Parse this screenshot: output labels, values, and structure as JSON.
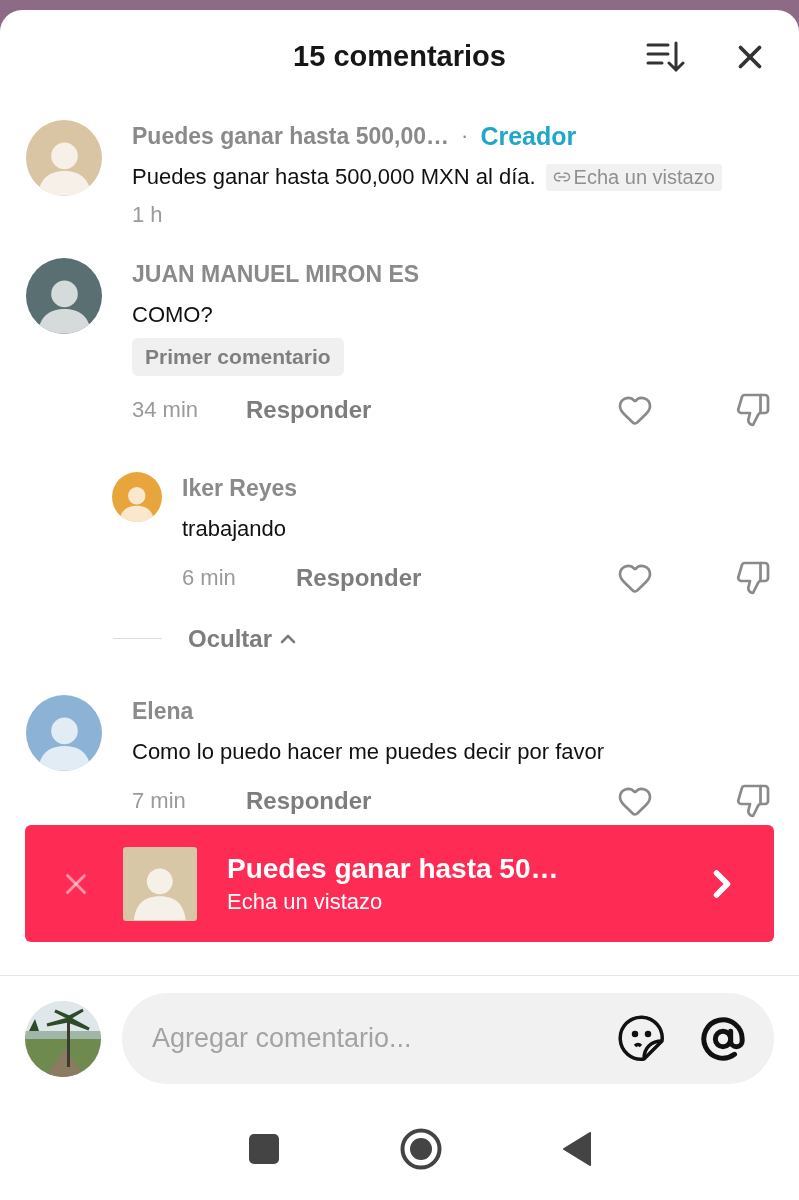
{
  "header": {
    "title": "15 comentarios"
  },
  "comments": [
    {
      "kind": "comment",
      "author": "Puedes ganar hasta 500,00…",
      "separator": "·",
      "author_tag": "Creador",
      "text": "Puedes ganar hasta 500,000 MXN al día.",
      "link": "Echa un vistazo",
      "time": "1 h"
    },
    {
      "kind": "comment",
      "author": "JUAN MANUEL MIRON ES",
      "text": "COMO?",
      "badge": "Primer comentario",
      "time": "34 min",
      "reply_label": "Responder"
    },
    {
      "kind": "reply",
      "author": "Iker Reyes",
      "text": "trabajando",
      "time": "6 min",
      "reply_label": "Responder"
    },
    {
      "kind": "toggle",
      "label": "Ocultar"
    },
    {
      "kind": "comment",
      "author": "Elena",
      "text": "Como lo puedo hacer me puedes decir por favor",
      "time": "7 min",
      "reply_label": "Responder"
    }
  ],
  "banner": {
    "title": "Puedes ganar hasta 50…",
    "subtitle": "Echa un vistazo"
  },
  "composer": {
    "placeholder": "Agregar comentario..."
  }
}
